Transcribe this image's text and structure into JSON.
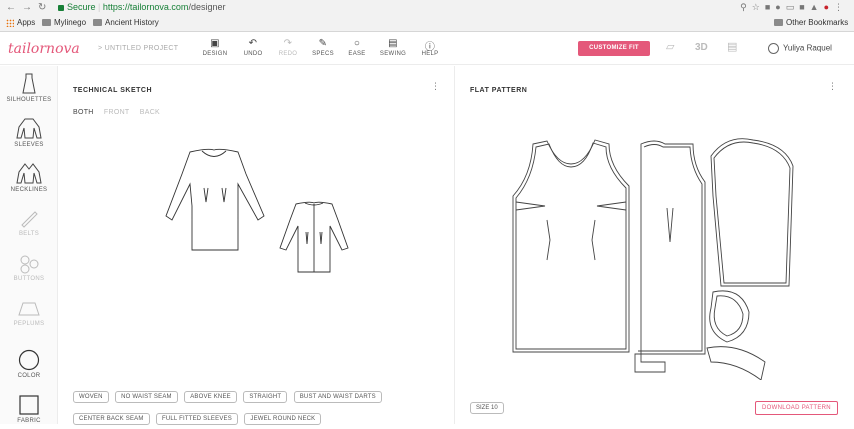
{
  "browser": {
    "secure_label": "Secure",
    "url_host": "https://tailornova.com",
    "url_path": "/designer",
    "bookmarks": [
      "Apps",
      "Mylinego",
      "Ancient History"
    ],
    "other_bookmarks": "Other Bookmarks"
  },
  "header": {
    "logo": "tailornova",
    "breadcrumb": "> UNTITLED PROJECT",
    "tools": [
      {
        "label": "DESIGN",
        "icon": "design-icon"
      },
      {
        "label": "UNDO",
        "icon": "undo-icon"
      },
      {
        "label": "REDO",
        "icon": "redo-icon"
      },
      {
        "label": "SPECS",
        "icon": "pencil-icon"
      },
      {
        "label": "EASE",
        "icon": "circle-icon"
      },
      {
        "label": "SEWING",
        "icon": "book-icon"
      },
      {
        "label": "HELP",
        "icon": "help-icon"
      }
    ],
    "customize_fit": "CUSTOMIZE FIT",
    "view_3d": "3D",
    "user_name": "Yuliya Raquel"
  },
  "sidebar": {
    "items": [
      {
        "label": "SILHOUETTES",
        "icon": "dress-icon",
        "enabled": true
      },
      {
        "label": "SLEEVES",
        "icon": "sleeves-icon",
        "enabled": true
      },
      {
        "label": "NECKLINES",
        "icon": "neckline-icon",
        "enabled": true
      },
      {
        "label": "BELTS",
        "icon": "belt-icon",
        "enabled": false
      },
      {
        "label": "BUTTONS",
        "icon": "buttons-icon",
        "enabled": false
      },
      {
        "label": "PEPLUMS",
        "icon": "peplum-icon",
        "enabled": false
      },
      {
        "label": "COLOR",
        "icon": "color-circle-icon",
        "enabled": true
      },
      {
        "label": "FABRIC",
        "icon": "fabric-square-icon",
        "enabled": true
      }
    ]
  },
  "sketch": {
    "title": "TECHNICAL SKETCH",
    "views": [
      "BOTH",
      "FRONT",
      "BACK"
    ],
    "active_view": "BOTH",
    "tags": [
      "WOVEN",
      "NO WAIST SEAM",
      "ABOVE KNEE",
      "STRAIGHT",
      "BUST AND WAIST DARTS",
      "CENTER BACK SEAM",
      "FULL FITTED SLEEVES",
      "JEWEL ROUND NECK"
    ]
  },
  "pattern": {
    "title": "FLAT PATTERN",
    "size": "SIZE 10",
    "download": "DOWNLOAD PATTERN"
  },
  "colors": {
    "accent": "#e4587a"
  }
}
